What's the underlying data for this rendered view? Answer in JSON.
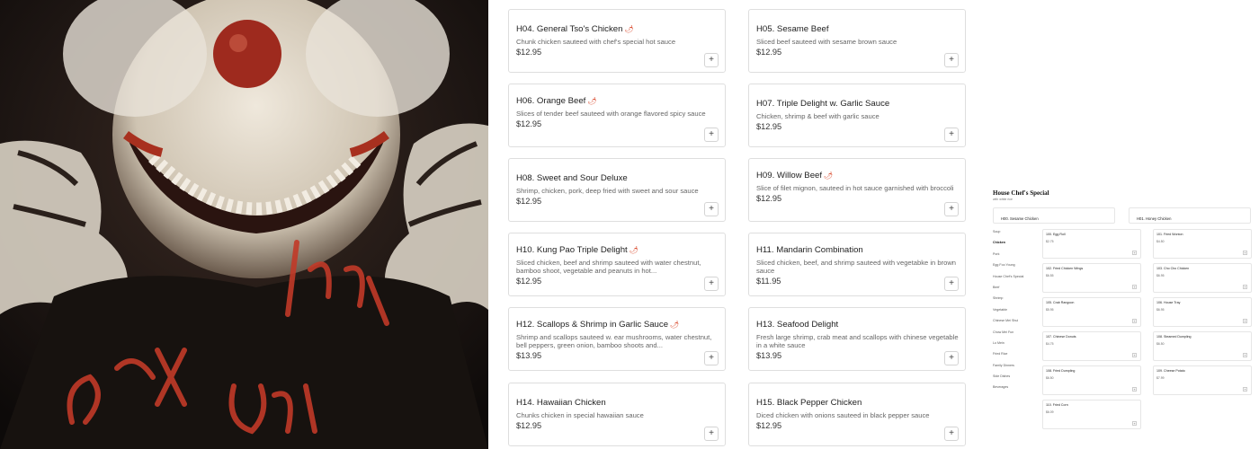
{
  "artwork": {
    "scrawl_text": "sex you",
    "colors": {
      "background": "#1a1512",
      "paint_red": "#c13a28",
      "skin": "#e8e2d8"
    }
  },
  "hot_icon": "chili-pepper-icon",
  "add_label": "+",
  "menu_items": [
    {
      "code_name": "H04. General Tso's Chicken",
      "spicy": true,
      "description": "Chunk chicken sauteed with chef's special hot sauce",
      "price": "$12.95"
    },
    {
      "code_name": "H05. Sesame Beef",
      "spicy": false,
      "description": "Sliced beef sauteed with sesame brown sauce",
      "price": "$12.95"
    },
    {
      "code_name": "H06. Orange Beef",
      "spicy": true,
      "description": "Slices of tender beef sauteed with orange flavored spicy sauce",
      "price": "$12.95"
    },
    {
      "code_name": "H07. Triple Delight w. Garlic Sauce",
      "spicy": false,
      "description": "Chicken, shrimp & beef with garlic sauce",
      "price": "$12.95"
    },
    {
      "code_name": "H08. Sweet and Sour Deluxe",
      "spicy": false,
      "description": "Shrimp, chicken, pork, deep fried with sweet and sour sauce",
      "price": "$12.95"
    },
    {
      "code_name": "H09. Willow Beef",
      "spicy": true,
      "description": "Slice of filet mignon, sauteed in hot sauce garnished with broccoli",
      "price": "$12.95"
    },
    {
      "code_name": "H10. Kung Pao Triple Delight",
      "spicy": true,
      "description": "Sliced chicken, beef and shrimp sauteed with water chestnut, bamboo shoot, vegetable and peanuts in hot...",
      "price": "$12.95"
    },
    {
      "code_name": "H11. Mandarin Combination",
      "spicy": false,
      "description": "Sliced chicken, beef, and shrimp sauteed with vegetabke in brown sauce",
      "price": "$11.95"
    },
    {
      "code_name": "H12. Scallops & Shrimp in Garlic Sauce",
      "spicy": true,
      "description": "Shrimp and scallops sauteed w. ear mushrooms, water chestnut, bell peppers, green onion, bamboo shoots and...",
      "price": "$13.95"
    },
    {
      "code_name": "H13. Seafood Delight",
      "spicy": false,
      "description": "Fresh large shrimp, crab meat and scallops with chinese vegetable in a white sauce",
      "price": "$13.95"
    },
    {
      "code_name": "H14. Hawaiian Chicken",
      "spicy": false,
      "description": "Chunks chicken in special hawaiian sauce",
      "price": "$12.95"
    },
    {
      "code_name": "H15. Black Pepper Chicken",
      "spicy": false,
      "description": "Diced chicken with onions sauteed in black pepper sauce",
      "price": "$12.95"
    }
  ],
  "mini_preview": {
    "title": "House Chef's Special",
    "subtitle": "with white rice",
    "featured": [
      "H00. Sesame Chicken",
      "H01. Honey Chicken"
    ],
    "nav": [
      "Soup",
      "Chicken",
      "Pork",
      "Egg Foo Young",
      "House Chef's Special",
      "Beef",
      "Shrimp",
      "Vegetable",
      "Chinese Mei Shui",
      "Chow Mei Fun",
      "Lo Mein",
      "Fried Rice",
      "Family Dinners",
      "Side Dishes",
      "Beverages"
    ],
    "active_nav": "Chicken",
    "items": [
      {
        "name": "100. Egg Roll",
        "price": "$2.75"
      },
      {
        "name": "101. Fried Wonton",
        "price": "$4.50"
      },
      {
        "name": "102. Fried Chicken Wings",
        "price": "$6.55"
      },
      {
        "name": "103. Cho Cho Chicken",
        "price": "$6.95"
      },
      {
        "name": "105. Crab Rangoon",
        "price": "$5.95"
      },
      {
        "name": "106. House Tray",
        "price": "$6.95"
      },
      {
        "name": "107. Chinese Donuts",
        "price": "$4.75"
      },
      {
        "name": "108. Steamed Dumpling",
        "price": "$6.50"
      },
      {
        "name": "108. Fried Dumpling",
        "price": "$6.50"
      },
      {
        "name": "109. Cheese Potato",
        "price": "$7.99"
      },
      {
        "name": "110. Fried Corn",
        "price": "$6.09"
      }
    ]
  }
}
